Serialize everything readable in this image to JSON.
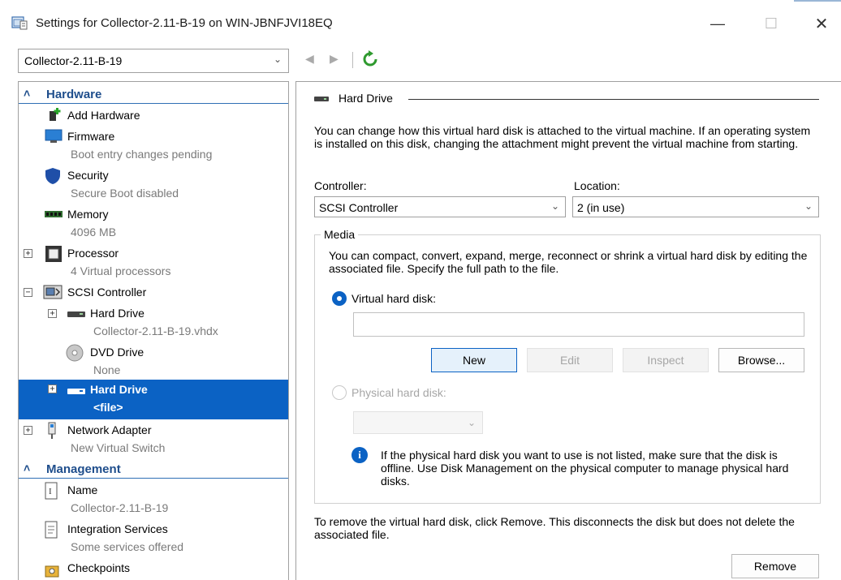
{
  "window": {
    "title": "Settings for Collector-2.11-B-19 on WIN-JBNFJVI18EQ",
    "minimize_glyph": "—",
    "maximize_glyph": "☐",
    "close_glyph": "✕"
  },
  "toolbar": {
    "vm_selected": "Collector-2.11-B-19",
    "back_glyph": "◀",
    "forward_glyph": "▶"
  },
  "tree": {
    "hardware_header": "Hardware",
    "management_header": "Management",
    "items": {
      "add_hardware": {
        "name": "Add Hardware"
      },
      "firmware": {
        "name": "Firmware",
        "sub": "Boot entry changes pending"
      },
      "security": {
        "name": "Security",
        "sub": "Secure Boot disabled"
      },
      "memory": {
        "name": "Memory",
        "sub": "4096 MB"
      },
      "processor": {
        "name": "Processor",
        "sub": "4 Virtual processors"
      },
      "scsi": {
        "name": "SCSI Controller"
      },
      "hard_drive_1": {
        "name": "Hard Drive",
        "sub": "Collector-2.11-B-19.vhdx"
      },
      "dvd_drive": {
        "name": "DVD Drive",
        "sub": "None"
      },
      "hard_drive_2": {
        "name": "Hard Drive",
        "sub": "<file>"
      },
      "network": {
        "name": "Network Adapter",
        "sub": "New Virtual Switch"
      },
      "name": {
        "name": "Name",
        "sub": "Collector-2.11-B-19"
      },
      "integration": {
        "name": "Integration Services",
        "sub": "Some services offered"
      },
      "checkpoints": {
        "name": "Checkpoints"
      }
    }
  },
  "panel": {
    "group_title": "Hard Drive",
    "intro": "You can change how this virtual hard disk is attached to the virtual machine. If an operating system is installed on this disk, changing the attachment might prevent the virtual machine from starting.",
    "controller_label": "Controller:",
    "controller_value": "SCSI Controller",
    "location_label": "Location:",
    "location_value": "2 (in use)",
    "media_title": "Media",
    "media_desc": "You can compact, convert, expand, merge, reconnect or shrink a virtual hard disk by editing the associated file. Specify the full path to the file.",
    "vhd_label": "Virtual hard disk:",
    "vhd_value": "",
    "buttons": {
      "new": "New",
      "edit": "Edit",
      "inspect": "Inspect",
      "browse": "Browse..."
    },
    "phd_label": "Physical hard disk:",
    "info_text": "If the physical hard disk you want to use is not listed, make sure that the disk is offline. Use Disk Management on the physical computer to manage physical hard disks.",
    "remove_text": "To remove the virtual hard disk, click Remove. This disconnects the disk but does not delete the associated file.",
    "remove_button": "Remove"
  }
}
